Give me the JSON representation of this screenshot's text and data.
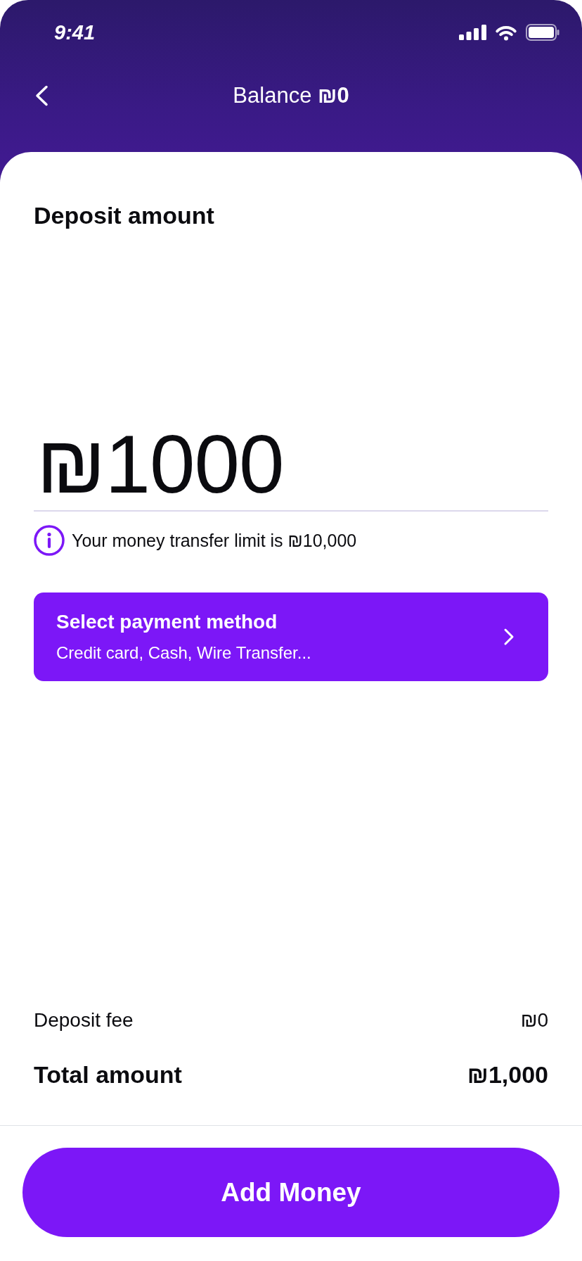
{
  "status_bar": {
    "time": "9:41"
  },
  "header": {
    "title": "Balance **₪0**"
  },
  "deposit": {
    "title": "Deposit amount",
    "amount": "₪1000",
    "limit_note": "Your money transfer limit is ₪10,000"
  },
  "payment_method": {
    "title": "Select payment method",
    "subtitle": "Credit card, Cash, Wire Transfer..."
  },
  "summary": [
    {
      "kind": "regular",
      "label": "Deposit fee",
      "value": "₪0"
    },
    {
      "kind": "total",
      "label": "Total amount",
      "value": "₪1,000"
    }
  ],
  "primary_button": {
    "label": "Add Money"
  }
}
